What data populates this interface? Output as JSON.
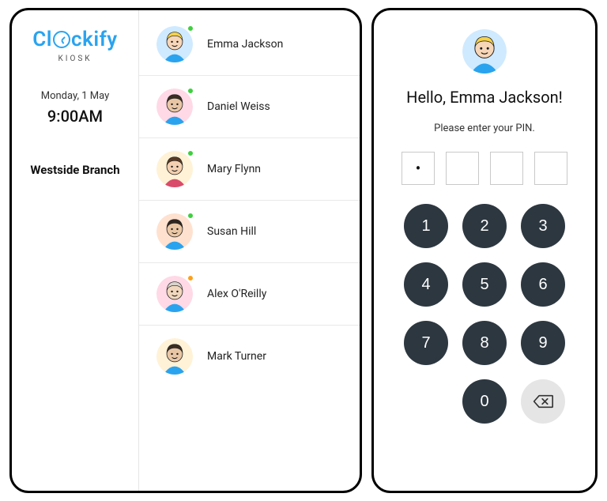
{
  "brand": {
    "name": "Clockify",
    "sub": "KIOSK"
  },
  "date": "Monday, 1 May",
  "time": "9:00AM",
  "branch": "Westside Branch",
  "people": [
    {
      "name": "Emma Jackson",
      "status": "green",
      "avatar": {
        "bg": "#cfeaff",
        "hair": "#f4d24a",
        "skin": "#f7d6b8",
        "shirt": "#2aa3ef"
      }
    },
    {
      "name": "Daniel Weiss",
      "status": "green",
      "avatar": {
        "bg": "#ffd9e6",
        "hair": "#3a2e22",
        "skin": "#e8c6a5",
        "shirt": "#2aa3ef"
      }
    },
    {
      "name": "Mary Flynn",
      "status": "green",
      "avatar": {
        "bg": "#fff2d6",
        "hair": "#5a3b24",
        "skin": "#f3d0b1",
        "shirt": "#d94b6a"
      }
    },
    {
      "name": "Susan Hill",
      "status": "green",
      "avatar": {
        "bg": "#ffe1cf",
        "hair": "#2f2620",
        "skin": "#e9c7a5",
        "shirt": "#2aa3ef"
      }
    },
    {
      "name": "Alex O'Reilly",
      "status": "orange",
      "avatar": {
        "bg": "#ffd9e6",
        "hair": "#d9d4cc",
        "skin": "#f1d7bd",
        "shirt": "#2aa3ef"
      }
    },
    {
      "name": "Mark Turner",
      "status": "none",
      "avatar": {
        "bg": "#fff2d6",
        "hair": "#3a2e22",
        "skin": "#e8c6a5",
        "shirt": "#2aa3ef"
      }
    }
  ],
  "pin_screen": {
    "user": "Emma Jackson",
    "avatar": {
      "bg": "#cfeaff",
      "hair": "#f4d24a",
      "skin": "#f7d6b8",
      "shirt": "#2aa3ef"
    },
    "greeting_prefix": "Hello, ",
    "greeting_suffix": "!",
    "prompt": "Please enter your PIN.",
    "entered": [
      "•",
      "",
      "",
      ""
    ],
    "keys": [
      "1",
      "2",
      "3",
      "4",
      "5",
      "6",
      "7",
      "8",
      "9",
      "",
      "0",
      "backspace"
    ]
  }
}
